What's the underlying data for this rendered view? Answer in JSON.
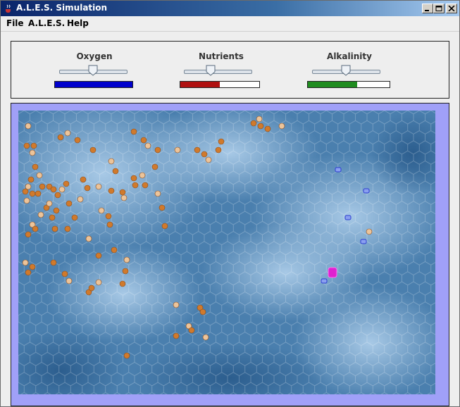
{
  "window": {
    "title": "A.L.E.S. Simulation",
    "icon": "java-cup-icon",
    "buttons": [
      "minimize-icon",
      "maximize-icon",
      "close-icon"
    ]
  },
  "menu": {
    "items": [
      {
        "label": "File"
      },
      {
        "label": "A.L.E.S."
      },
      {
        "label": "Help"
      }
    ]
  },
  "controls": [
    {
      "label": "Oxygen",
      "slider_value": 0.5,
      "meter_level": 1.0,
      "meter_color": "#0000cc"
    },
    {
      "label": "Nutrients",
      "slider_value": 0.4,
      "meter_level": 0.5,
      "meter_color": "#b01010"
    },
    {
      "label": "Alkalinity",
      "slider_value": 0.5,
      "meter_level": 0.6,
      "meter_color": "#1f8c1f"
    }
  ],
  "simulation": {
    "panel_color": "#a0a0f8",
    "background": "blue-hexagon-grid-clouds",
    "organism_colors": {
      "orange": "#d07a2c",
      "tan": "#ecc49a",
      "blue": "#2c3cd0",
      "magenta": "#e020d0"
    }
  }
}
